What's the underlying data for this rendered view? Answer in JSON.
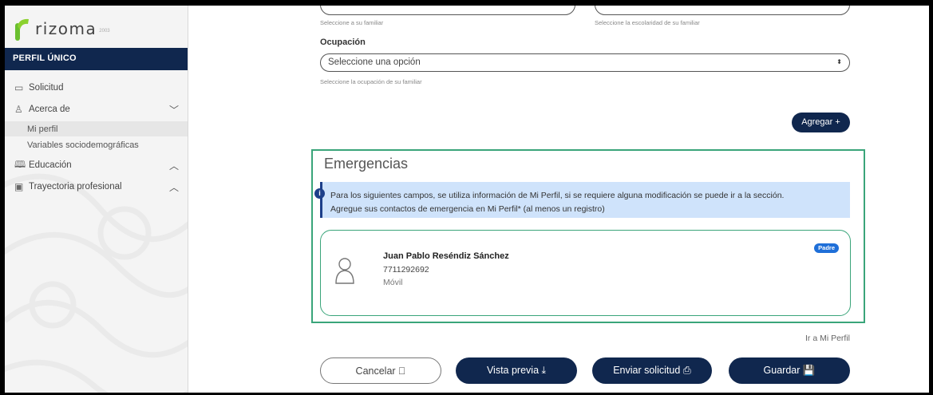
{
  "app": {
    "logo_text": "rizoma",
    "logo_sub": "2003"
  },
  "sidebar": {
    "profile_title": "PERFIL ÚNICO",
    "items": [
      {
        "label": "Solicitud",
        "icon": "document-icon"
      },
      {
        "label": "Acerca de",
        "icon": "user-icon",
        "chevron": "chevron-down"
      },
      {
        "label": "Mi perfil",
        "sub": true,
        "active": true
      },
      {
        "label": "Variables sociodemográficas",
        "sub": true
      },
      {
        "label": "Educación",
        "icon": "book-icon",
        "chevron": "chevron-up"
      },
      {
        "label": "Trayectoria profesional",
        "icon": "badge-icon",
        "chevron": "chevron-up"
      }
    ]
  },
  "form": {
    "familiar_hint": "Seleccione a su familiar",
    "escolaridad_hint": "Seleccione la escolaridad de su familiar",
    "ocupacion_label": "Ocupación",
    "ocupacion_value": "Seleccione una opción",
    "ocupacion_hint": "Seleccione la ocupación de su familiar",
    "add_button": "Agregar  +"
  },
  "emergencias": {
    "title": "Emergencias",
    "info_line1": "Para los siguientes campos, se utiliza información de Mi Perfil, si se requiere alguna modificación se puede ir a la sección.",
    "info_line2": "Agregue sus contactos de emergencia en Mi Perfil* (al menos un registro)",
    "contact": {
      "name": "Juan Pablo Reséndiz Sánchez",
      "phone": "7711292692",
      "type": "Móvil",
      "badge": "Padre"
    },
    "link": "Ir a Mi Perfil"
  },
  "actions": {
    "cancel": "Cancelar",
    "preview": "Vista previa",
    "send": "Enviar solicitud",
    "save": "Guardar"
  },
  "colors": {
    "navy": "#10274e",
    "green": "#3aa57a",
    "info_bg": "#cfe3fb",
    "badge": "#1f6fd8"
  }
}
